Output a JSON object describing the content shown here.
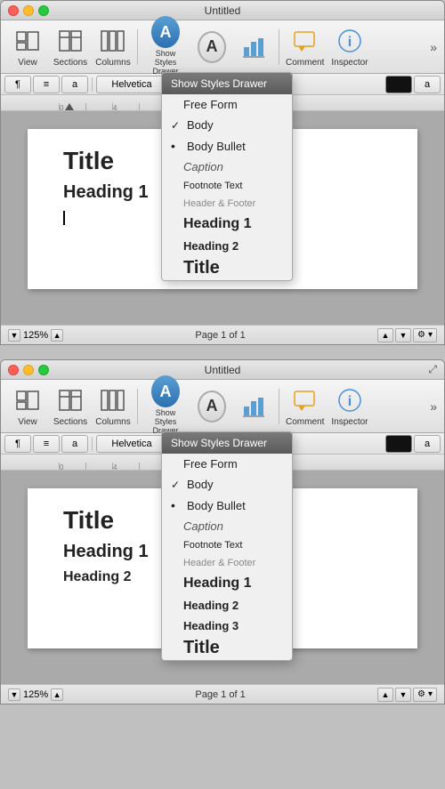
{
  "window1": {
    "title": "Untitled",
    "toolbar": {
      "view_label": "View",
      "sections_label": "Sections",
      "columns_label": "Columns",
      "styles_label": "Show Styles Drawer",
      "comment_label": "Comment",
      "inspector_label": "Inspector"
    },
    "format_bar": {
      "font_name": "Helvetica",
      "size": "a"
    },
    "dropdown": {
      "header": "Show Styles Drawer",
      "items": [
        {
          "label": "Free Form",
          "style": "normal",
          "checked": false
        },
        {
          "label": "Body",
          "style": "normal",
          "checked": true
        },
        {
          "label": "Body Bullet",
          "style": "bullet",
          "checked": false
        },
        {
          "label": "Caption",
          "style": "caption",
          "checked": false
        },
        {
          "label": "Footnote Text",
          "style": "footnote",
          "checked": false
        },
        {
          "label": "Header & Footer",
          "style": "hf",
          "checked": false
        },
        {
          "label": "Heading 1",
          "style": "heading1",
          "checked": false
        },
        {
          "label": "Heading 2",
          "style": "heading2",
          "checked": false
        },
        {
          "label": "Title",
          "style": "title",
          "checked": false
        }
      ]
    },
    "document": {
      "title": "Title",
      "heading1": "Heading 1"
    },
    "status": {
      "zoom": "125%",
      "page": "Page 1 of 1"
    }
  },
  "window2": {
    "title": "Untitled",
    "toolbar": {
      "view_label": "View",
      "sections_label": "Sections",
      "columns_label": "Columns",
      "styles_label": "Show Styles Drawer",
      "comment_label": "Comment",
      "inspector_label": "Inspector"
    },
    "format_bar": {
      "font_name": "Helvetica",
      "size": "a"
    },
    "dropdown": {
      "header": "Show Styles Drawer",
      "items": [
        {
          "label": "Free Form",
          "style": "normal",
          "checked": false
        },
        {
          "label": "Body",
          "style": "normal",
          "checked": true
        },
        {
          "label": "Body Bullet",
          "style": "bullet",
          "checked": false
        },
        {
          "label": "Caption",
          "style": "caption",
          "checked": false
        },
        {
          "label": "Footnote Text",
          "style": "footnote",
          "checked": false
        },
        {
          "label": "Header & Footer",
          "style": "hf",
          "checked": false
        },
        {
          "label": "Heading 1",
          "style": "heading1",
          "checked": false
        },
        {
          "label": "Heading 2",
          "style": "heading2",
          "checked": false
        },
        {
          "label": "Heading 3",
          "style": "heading3",
          "checked": false
        },
        {
          "label": "Title",
          "style": "title",
          "checked": false
        }
      ]
    },
    "document": {
      "title": "Title",
      "heading1": "Heading 1",
      "heading2": "Heading 2"
    },
    "status": {
      "zoom": "125%",
      "page": "Page 1 of 1"
    }
  }
}
